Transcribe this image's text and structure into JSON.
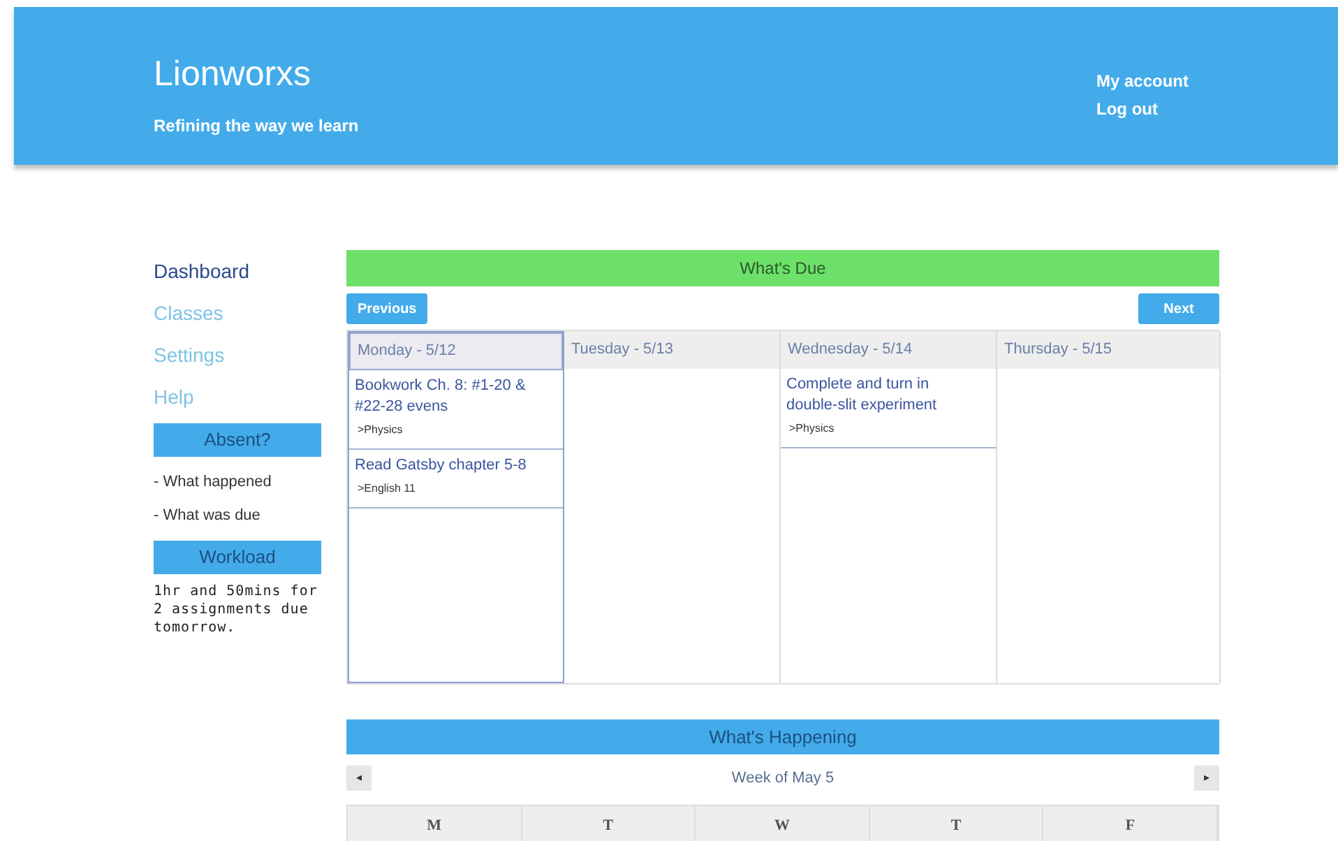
{
  "header": {
    "title": "Lionworxs",
    "tagline": "Refining the way we learn",
    "links": [
      "My account",
      "Log out"
    ]
  },
  "sidebar": {
    "items": [
      {
        "label": "Dashboard",
        "selected": true
      },
      {
        "label": "Classes",
        "selected": false
      },
      {
        "label": "Settings",
        "selected": false
      },
      {
        "label": "Help",
        "selected": false
      }
    ],
    "absent": {
      "title": "Absent?",
      "links": [
        "- What happened",
        "- What was due"
      ]
    },
    "workload": {
      "title": "Workload",
      "text": "1hr and 50mins for 2 assignments due tomorrow."
    }
  },
  "whats_due": {
    "title": "What's Due",
    "previous": "Previous",
    "next": "Next",
    "days": [
      {
        "label": "Monday - 5/12",
        "selected": true,
        "assignments": [
          {
            "title": "Bookwork Ch. 8: #1-20 & #22-28 evens",
            "class": ">Physics"
          },
          {
            "title": "Read Gatsby chapter 5-8",
            "class": ">English 11"
          }
        ]
      },
      {
        "label": "Tuesday - 5/13",
        "selected": false
      },
      {
        "label": "Wednesday - 5/14",
        "selected": false,
        "assignments": [
          {
            "title": "Complete and turn in double-slit experiment",
            "class": ">Physics"
          }
        ]
      },
      {
        "label": "Thursday - 5/15",
        "selected": false
      }
    ]
  },
  "whats_happening": {
    "title": "What's Happening",
    "prev": "◂",
    "next": "▸",
    "week": "Week of May 5",
    "weekdays": [
      "M",
      "T",
      "W",
      "T",
      "F"
    ]
  }
}
